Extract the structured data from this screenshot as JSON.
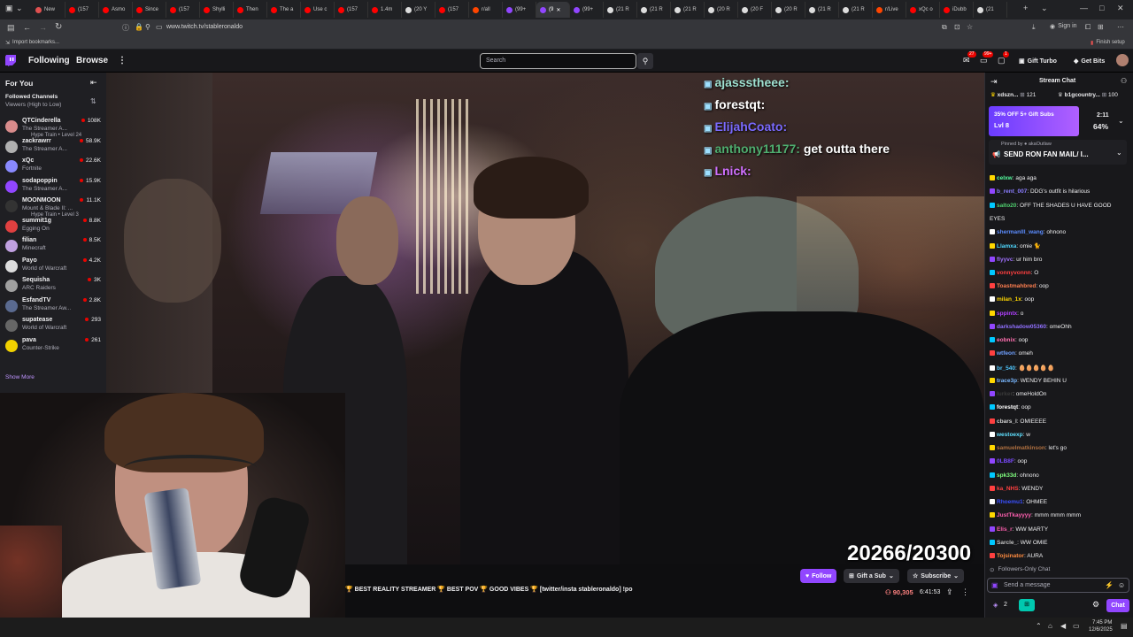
{
  "browser": {
    "tabs": [
      {
        "label": "New",
        "color": "#e05050"
      },
      {
        "label": "(157",
        "color": "#ff0000"
      },
      {
        "label": "Asmo",
        "color": "#ff0000"
      },
      {
        "label": "Since",
        "color": "#ff0000"
      },
      {
        "label": "(157",
        "color": "#ff0000"
      },
      {
        "label": "Shylli",
        "color": "#ff0000"
      },
      {
        "label": "Then",
        "color": "#ff0000"
      },
      {
        "label": "The a",
        "color": "#ff0000"
      },
      {
        "label": "Use c",
        "color": "#ff0000"
      },
      {
        "label": "(157",
        "color": "#ff0000"
      },
      {
        "label": "1.4m",
        "color": "#ff0000"
      },
      {
        "label": "(20 Y",
        "color": "#dddddd"
      },
      {
        "label": "(157",
        "color": "#ff0000"
      },
      {
        "label": "r/all",
        "color": "#ff4500"
      },
      {
        "label": "(99+",
        "color": "#9146ff"
      },
      {
        "label": "(9",
        "color": "#9146ff"
      },
      {
        "label": "(99+",
        "color": "#9146ff"
      },
      {
        "label": "(21 R",
        "color": "#dddddd"
      },
      {
        "label": "(21 R",
        "color": "#dddddd"
      },
      {
        "label": "(21 R",
        "color": "#dddddd"
      },
      {
        "label": "(20 R",
        "color": "#dddddd"
      },
      {
        "label": "(20 F",
        "color": "#dddddd"
      },
      {
        "label": "(20 R",
        "color": "#dddddd"
      },
      {
        "label": "(21 R",
        "color": "#dddddd"
      },
      {
        "label": "(21 R",
        "color": "#dddddd"
      },
      {
        "label": "r/Live",
        "color": "#ff4500"
      },
      {
        "label": "xQc o",
        "color": "#ff0000"
      },
      {
        "label": "iDubb",
        "color": "#ff0000"
      },
      {
        "label": "(21",
        "color": "#dddddd"
      }
    ],
    "url": "www.twitch.tv/stableronaldo",
    "sign_in": "Sign in",
    "import_bookmarks": "Import bookmarks...",
    "finish_setup": "Finish setup"
  },
  "nav": {
    "following": "Following",
    "browse": "Browse",
    "search_placeholder": "Search",
    "badge_notifications": "27",
    "badge_inbox": "99+",
    "badge_whispers": "1",
    "gift_turbo": "Gift Turbo",
    "get_bits": "Get Bits"
  },
  "sidebar": {
    "for_you": "For You",
    "followed_channels": "Followed Channels",
    "sort": "Viewers (High to Low)",
    "show_more": "Show More",
    "channels": [
      {
        "name": "QTCinderella",
        "game": "The Streamer A...",
        "viewers": "108K",
        "extra": "Hype Train • Level 24",
        "color": "#d98c8c"
      },
      {
        "name": "zackrawrr",
        "game": "The Streamer A...",
        "viewers": "58.9K",
        "extra": "",
        "color": "#b0b0b0"
      },
      {
        "name": "xQc",
        "game": "Fortnite",
        "viewers": "22.6K",
        "extra": "",
        "color": "#8a8aff"
      },
      {
        "name": "sodapoppin",
        "game": "The Streamer A...",
        "viewers": "15.9K",
        "extra": "",
        "color": "#9146ff"
      },
      {
        "name": "MOONMOON",
        "game": "Mount & Blade II: ...",
        "viewers": "11.1K",
        "extra": "Hype Train • Level 3",
        "color": "#333333"
      },
      {
        "name": "summit1g",
        "game": "Egging On",
        "viewers": "8.8K",
        "extra": "",
        "color": "#e04040"
      },
      {
        "name": "filian",
        "game": "Minecraft",
        "viewers": "8.5K",
        "extra": "",
        "color": "#c0a0e0"
      },
      {
        "name": "Payo",
        "game": "World of Warcraft",
        "viewers": "4.2K",
        "extra": "",
        "color": "#dddddd"
      },
      {
        "name": "Sequisha",
        "game": "ARC Raiders",
        "viewers": "3K",
        "extra": "",
        "color": "#a0a0a0"
      },
      {
        "name": "EsfandTV",
        "game": "The Streamer Aw...",
        "viewers": "2.8K",
        "extra": "",
        "color": "#5a6a90"
      },
      {
        "name": "supatease",
        "game": "World of Warcraft",
        "viewers": "293",
        "extra": "",
        "color": "#666666"
      },
      {
        "name": "pava",
        "game": "Counter-Strike",
        "viewers": "261",
        "extra": "",
        "color": "#f0d000"
      }
    ]
  },
  "video": {
    "overlay_chat": [
      {
        "user": "ajassstheee:",
        "text": "",
        "color": "#9ee0d0"
      },
      {
        "user": "forestqt:",
        "text": "",
        "color": "#ffffff"
      },
      {
        "user": "ElijahCoato:",
        "text": "",
        "color": "#7a6aff"
      },
      {
        "user": "anthony11177:",
        "text": "get outta there",
        "color": "#4fae6f"
      },
      {
        "user": "Lnick:",
        "text": "",
        "color": "#d070ff"
      }
    ],
    "counter": "20266/20300"
  },
  "stream": {
    "title": "🏆 BEST REALITY STREAMER 🏆 BEST POV 🏆 GOOD VIBES 🏆 [twitter/insta stableronaldo] !po",
    "follow": "Follow",
    "gift_sub": "Gift a Sub",
    "subscribe": "Subscribe",
    "viewers": "90,305",
    "uptime": "6:41:53"
  },
  "chat": {
    "header": "Stream Chat",
    "gift_leaders": [
      {
        "name": "xdszn...",
        "count": "121"
      },
      {
        "name": "b1gcountry...",
        "count": "100"
      }
    ],
    "hype_offer": "35% OFF 5+ Gift Subs",
    "hype_level": "Lvl 8",
    "hype_timer": "2:11",
    "hype_progress": "64%",
    "pinned_by": "Pinned by ● akaOutlaw",
    "pinned_text": "SEND RON FAN MAIL/ I...",
    "messages": [
      {
        "user": "celxw",
        "text": "aga aga",
        "color": "#54ff9f"
      },
      {
        "user": "b_rent_007",
        "text": "DDG's outfit is hilarious",
        "color": "#8a7dff"
      },
      {
        "user": "salto20",
        "text": "OFF THE SHADES U HAVE GOOD",
        "color": "#4fcf6f"
      },
      {
        "user": "",
        "text": "EYES",
        "color": "#4fcf6f"
      },
      {
        "user": "shermanlll_wang",
        "text": "ohnono",
        "color": "#5b8cff"
      },
      {
        "user": "Llamxa",
        "text": "omie 🐈",
        "color": "#4fd8ff"
      },
      {
        "user": "flyyvc",
        "text": "ur him bro",
        "color": "#a070ff"
      },
      {
        "user": "vonnyvonnn",
        "text": "O",
        "color": "#ff4040"
      },
      {
        "user": "Toastmahbred",
        "text": "oop",
        "color": "#ff7f50"
      },
      {
        "user": "milan_1x",
        "text": "oop",
        "color": "#ffd700"
      },
      {
        "user": "sppintx",
        "text": "o",
        "color": "#b040ff"
      },
      {
        "user": "darkshadow05360",
        "text": "omeOhh",
        "color": "#9070ff"
      },
      {
        "user": "eobnix",
        "text": "oop",
        "color": "#ff6fb0"
      },
      {
        "user": "wtfeon",
        "text": "omeh",
        "color": "#6fa0ff"
      },
      {
        "user": "br_540",
        "text": "🥚🥚🥚🥚🥚",
        "color": "#4fc8ff"
      },
      {
        "user": "trace3p",
        "text": "WENDY BEHIN U",
        "color": "#7ab8ff"
      },
      {
        "user": "lurker",
        "text": "omeHoldOn",
        "color": "#3a3a3a"
      },
      {
        "user": "forestqt",
        "text": "oop",
        "color": "#ffffff"
      },
      {
        "user": "cbars_l",
        "text": "OMIEEEE",
        "color": "#d0d0d0"
      },
      {
        "user": "westoexp",
        "text": "w",
        "color": "#5fe0ff"
      },
      {
        "user": "samuelmatkinson",
        "text": "let's go",
        "color": "#b07040"
      },
      {
        "user": "0LB8F",
        "text": "oop",
        "color": "#7a4aff"
      },
      {
        "user": "spk33d",
        "text": "ohnono",
        "color": "#80ff80"
      },
      {
        "user": "ka_NHS",
        "text": "WENDY",
        "color": "#ff4040"
      },
      {
        "user": "Rhoemu1",
        "text": "OHMEE",
        "color": "#3a50ff"
      },
      {
        "user": "JustTkayyyy",
        "text": "mmm mmm mmm",
        "color": "#ff5fb0"
      },
      {
        "user": "Elis_r",
        "text": "WW MARTY",
        "color": "#ff5fb0"
      },
      {
        "user": "Sarcle_",
        "text": "WW OMIE",
        "color": "#c0c0c0"
      },
      {
        "user": "Tojsinator",
        "text": "AURA",
        "color": "#ff8c40"
      }
    ],
    "followers_only": "Followers-Only Chat",
    "send_placeholder": "Send a message",
    "points": "2",
    "chat_button": "Chat"
  },
  "taskbar": {
    "time": "7:45 PM",
    "date": "12/6/2025"
  }
}
